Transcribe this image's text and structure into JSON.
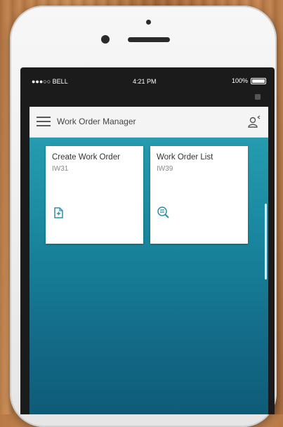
{
  "status_bar": {
    "carrier": "●●●○○ BELL",
    "time": "4:21 PM",
    "battery": "100%"
  },
  "header": {
    "title": "Work Order Manager"
  },
  "tiles": [
    {
      "title": "Create Work Order",
      "subtitle": "IW31",
      "icon": "create-document-icon"
    },
    {
      "title": "Work Order List",
      "subtitle": "IW39",
      "icon": "search-list-icon"
    }
  ],
  "colors": {
    "app_gradient_top": "#2aa2b4",
    "app_gradient_bottom": "#0f5b78",
    "header_bg": "#f4f4f4",
    "icon_accent": "#2a8fb0"
  }
}
